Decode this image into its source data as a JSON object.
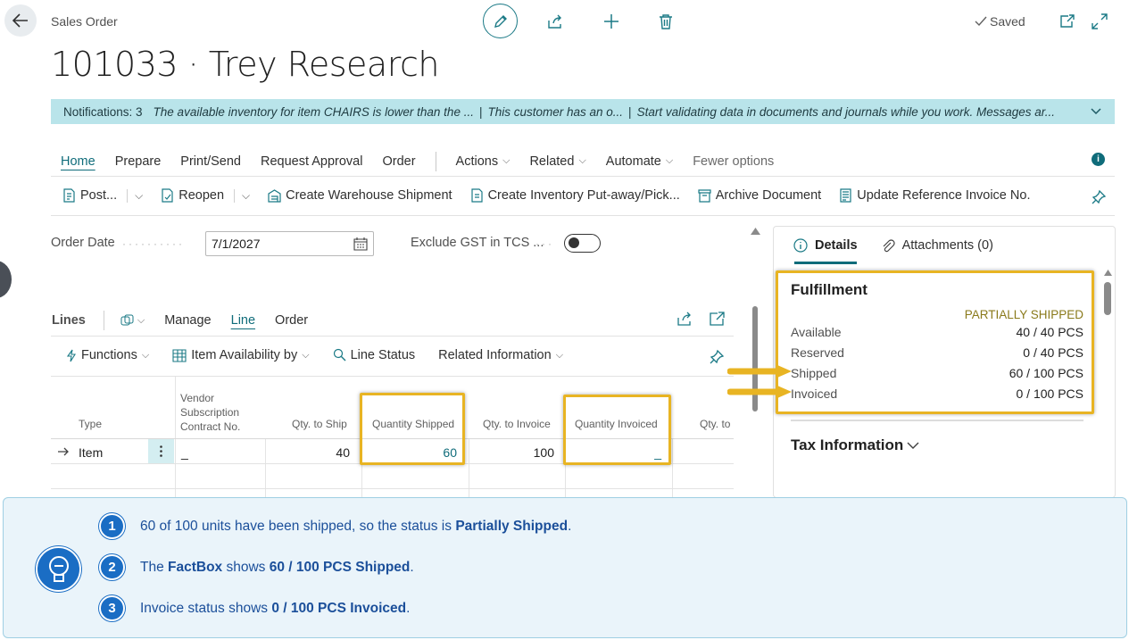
{
  "header": {
    "breadcrumb": "Sales Order",
    "title": "101033 · Trey Research",
    "saved_label": "Saved"
  },
  "notifications": {
    "count_label": "Notifications: 3",
    "messages": [
      "The available inventory for item CHAIRS is lower than the ...",
      "This customer has an o...",
      "Start validating data in documents and journals while you work. Messages ar..."
    ]
  },
  "tabs": {
    "home": "Home",
    "prepare": "Prepare",
    "print_send": "Print/Send",
    "request_approval": "Request Approval",
    "order": "Order",
    "actions": "Actions",
    "related": "Related",
    "automate": "Automate",
    "fewer_options": "Fewer options"
  },
  "actions": {
    "post": "Post...",
    "reopen": "Reopen",
    "create_warehouse_shipment": "Create Warehouse Shipment",
    "create_inventory_putaway": "Create Inventory Put-away/Pick...",
    "archive_document": "Archive Document",
    "update_reference_invoice": "Update Reference Invoice No."
  },
  "general": {
    "order_date_label": "Order Date",
    "order_date_value": "7/1/2027",
    "exclude_gst_label": "Exclude GST in TCS ..."
  },
  "lines": {
    "title": "Lines",
    "manage": "Manage",
    "line": "Line",
    "order": "Order",
    "functions": "Functions",
    "item_availability": "Item Availability by",
    "line_status": "Line Status",
    "related_information": "Related Information",
    "columns": {
      "type": "Type",
      "vendor_sub_1": "Vendor",
      "vendor_sub_2": "Subscription",
      "vendor_sub_3": "Contract No.",
      "qty_to_ship": "Qty. to Ship",
      "quantity_shipped": "Quantity Shipped",
      "qty_to_invoice": "Qty. to Invoice",
      "quantity_invoiced": "Quantity Invoiced",
      "qty_to": "Qty. to"
    },
    "row": {
      "type": "Item",
      "vendor_sub": "_",
      "qty_to_ship": "40",
      "quantity_shipped": "60",
      "qty_to_invoice": "100",
      "quantity_invoiced": "_"
    }
  },
  "factbox": {
    "details_tab": "Details",
    "attachments_tab": "Attachments (0)",
    "fulfillment_title": "Fulfillment",
    "status": "PARTIALLY SHIPPED",
    "rows": [
      {
        "label": "Available",
        "value": "40 / 40 PCS"
      },
      {
        "label": "Reserved",
        "value": "0 / 40 PCS"
      },
      {
        "label": "Shipped",
        "value": "60 / 100 PCS"
      },
      {
        "label": "Invoiced",
        "value": "0 / 100 PCS"
      }
    ],
    "tax_information": "Tax Information"
  },
  "callout": {
    "steps": [
      {
        "num": "1",
        "pre": "60 of 100 units have been shipped, so the status is ",
        "bold": "Partially Shipped",
        "post": "."
      },
      {
        "num": "2",
        "pre": "The ",
        "bold": "FactBox",
        "mid": " shows ",
        "bold2": "60 / 100 PCS Shipped",
        "post": "."
      },
      {
        "num": "3",
        "pre": "Invoice status shows ",
        "bold": "0 / 100 PCS Invoiced",
        "post": "."
      }
    ]
  },
  "colors": {
    "accent": "#0f6c7a",
    "highlight": "#e8b423",
    "notification_bg": "#b9e4ea",
    "callout_blue": "#1a6dc4"
  }
}
